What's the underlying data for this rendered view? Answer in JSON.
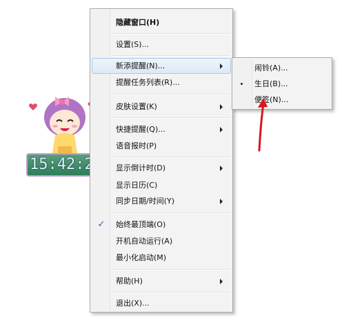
{
  "clock": {
    "time": "15:42:2"
  },
  "main_menu": {
    "items": [
      {
        "label": "隐藏窗口(H)"
      },
      {
        "label": "设置(S)..."
      },
      {
        "label": "新添提醒(N)..."
      },
      {
        "label": "提醒任务列表(R)..."
      },
      {
        "label": "皮肤设置(K)"
      },
      {
        "label": "快捷提醒(Q)..."
      },
      {
        "label": "语音报时(P)"
      },
      {
        "label": "显示倒计时(D)"
      },
      {
        "label": "显示日历(C)"
      },
      {
        "label": "同步日期/时间(Y)"
      },
      {
        "label": "始终最顶端(O)",
        "checked": true
      },
      {
        "label": "开机自动运行(A)"
      },
      {
        "label": "最小化启动(M)"
      },
      {
        "label": "帮助(H)"
      },
      {
        "label": "退出(X)..."
      }
    ],
    "check_mark": "✓"
  },
  "sub_menu": {
    "items": [
      {
        "label": "闹铃(A)..."
      },
      {
        "label": "生日(B)..."
      },
      {
        "label": "便签(N)..."
      }
    ]
  },
  "colors": {
    "annotation_arrow": "#d8161b",
    "highlight": "#dde9f7",
    "clock_bg": "#2f7d5a"
  }
}
